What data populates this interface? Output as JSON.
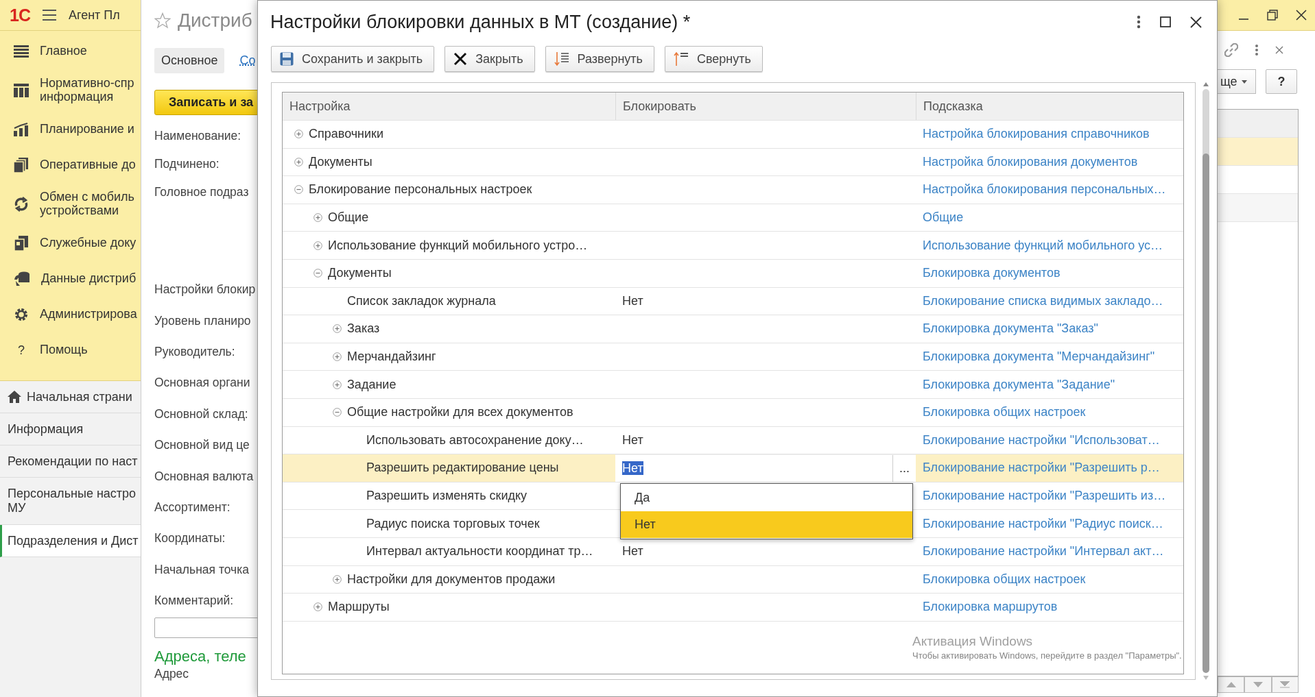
{
  "app_bar": {
    "logo": "1С",
    "title": "Агент Пл"
  },
  "sections": [
    {
      "label": "Главное"
    },
    {
      "label": "Нормативно-спр\nинформация"
    },
    {
      "label": "Планирование и"
    },
    {
      "label": "Оперативные до"
    },
    {
      "label": "Обмен с мобиль\nустройствами"
    },
    {
      "label": "Служебные доку"
    },
    {
      "label": "Данные дистриб"
    },
    {
      "label": "Администрирова"
    },
    {
      "label": "Помощь",
      "glyph": "?"
    }
  ],
  "open_windows": [
    {
      "label": "Начальная страни",
      "kind": "home",
      "selected": false
    },
    {
      "label": "Информация",
      "kind": "page",
      "selected": false
    },
    {
      "label": "Рекомендации по наст",
      "kind": "page",
      "selected": false
    },
    {
      "label": "Персональные настро\nМУ",
      "kind": "page",
      "selected": false
    },
    {
      "label": "Подразделения и Дист",
      "kind": "page",
      "selected": true
    }
  ],
  "form": {
    "title": "Дистриб",
    "tabs": [
      {
        "label": "Основное",
        "selected": true
      },
      {
        "label": "Со",
        "selected": false
      }
    ],
    "save_button": "Записать и за",
    "fields_top": [
      "Наименование:",
      "Подчинено:",
      "Головное подраз"
    ],
    "fields": [
      "Настройки блокир",
      "Уровень планиро",
      "Руководитель:",
      "Основная органи",
      "Основной склад:",
      "Основной вид це",
      "Основная валюта",
      "Ассортимент:",
      "Координаты:",
      "Начальная точка",
      "Комментарий:"
    ],
    "section_title": "Адреса, теле",
    "address_label": "Адрес"
  },
  "dialog": {
    "title": "Настройки блокировки данных в МТ (создание) *",
    "toolbar": [
      {
        "label": "Сохранить и закрыть",
        "kind": "save"
      },
      {
        "label": "Закрыть",
        "kind": "close"
      },
      {
        "label": "Развернуть",
        "kind": "expand"
      },
      {
        "label": "Свернуть",
        "kind": "collapse"
      }
    ],
    "columns": [
      "Настройка",
      "Блокировать",
      "Подсказка"
    ],
    "rows": [
      {
        "name": "Справочники",
        "hint": "Настройка блокирования справочников",
        "expanded": false,
        "selected": false
      },
      {
        "name": "Документы",
        "hint": "Настройка блокирования документов",
        "expanded": false,
        "selected": false
      },
      {
        "name": "Блокирование персональных настроек",
        "hint": "Настройка блокирования персональных…",
        "expanded": true,
        "selected": false,
        "children": [
          {
            "name": "Общие",
            "hint": "Общие",
            "expanded": false,
            "selected": false
          },
          {
            "name": "Использование функций мобильного устро…",
            "hint": "Использование функций мобильного ус…",
            "expanded": false,
            "selected": false
          },
          {
            "name": "Документы",
            "hint": "Блокировка документов",
            "expanded": true,
            "selected": false,
            "children": [
              {
                "name": "Список закладок журнала",
                "block": "Нет",
                "hint": "Блокирование списка видимых закладо…",
                "selected": false
              },
              {
                "name": "Заказ",
                "hint": "Блокировка документа \"Заказ\"",
                "expanded": false,
                "selected": false
              },
              {
                "name": "Мерчандайзинг",
                "hint": "Блокировка документа \"Мерчандайзинг\"",
                "expanded": false,
                "selected": false
              },
              {
                "name": "Задание",
                "hint": "Блокировка документа \"Задание\"",
                "expanded": false,
                "selected": false
              },
              {
                "name": "Общие настройки для всех документов",
                "hint": "Блокировка общих настроек",
                "expanded": true,
                "selected": false,
                "children": [
                  {
                    "name": "Использовать автосохранение доку…",
                    "block": "Нет",
                    "hint": "Блокирование настройки \"Использоват…",
                    "selected": false
                  },
                  {
                    "name": "Разрешить редактирование цены",
                    "block": "Нет",
                    "hint": "Блокирование настройки \"Разрешить р…",
                    "selected": true
                  },
                  {
                    "name": "Разрешить изменять скидку",
                    "hint": "Блокирование настройки \"Разрешить из…",
                    "selected": false
                  },
                  {
                    "name": "Радиус поиска торговых точек",
                    "hint": "Блокирование настройки \"Радиус поиск…",
                    "selected": false
                  },
                  {
                    "name": "Интервал актуальности координат тр…",
                    "block": "Нет",
                    "hint": "Блокирование настройки \"Интервал акт…",
                    "selected": false
                  }
                ]
              },
              {
                "name": "Настройки для документов продажи",
                "hint": "Блокировка общих настроек",
                "expanded": false,
                "selected": false
              }
            ]
          },
          {
            "name": "Маршруты",
            "hint": "Блокировка маршрутов",
            "expanded": false,
            "selected": false
          }
        ]
      }
    ],
    "choice_button": "...",
    "dropdown": {
      "options": [
        {
          "label": "Да",
          "selected": false
        },
        {
          "label": "Нет",
          "selected": true
        }
      ]
    }
  },
  "back_window": {
    "more_button": "ще",
    "help_button": "?"
  },
  "os_notice": {
    "title": "Активация Windows",
    "text": "Чтобы активировать Windows, перейдите в раздел \"Параметры\"."
  }
}
